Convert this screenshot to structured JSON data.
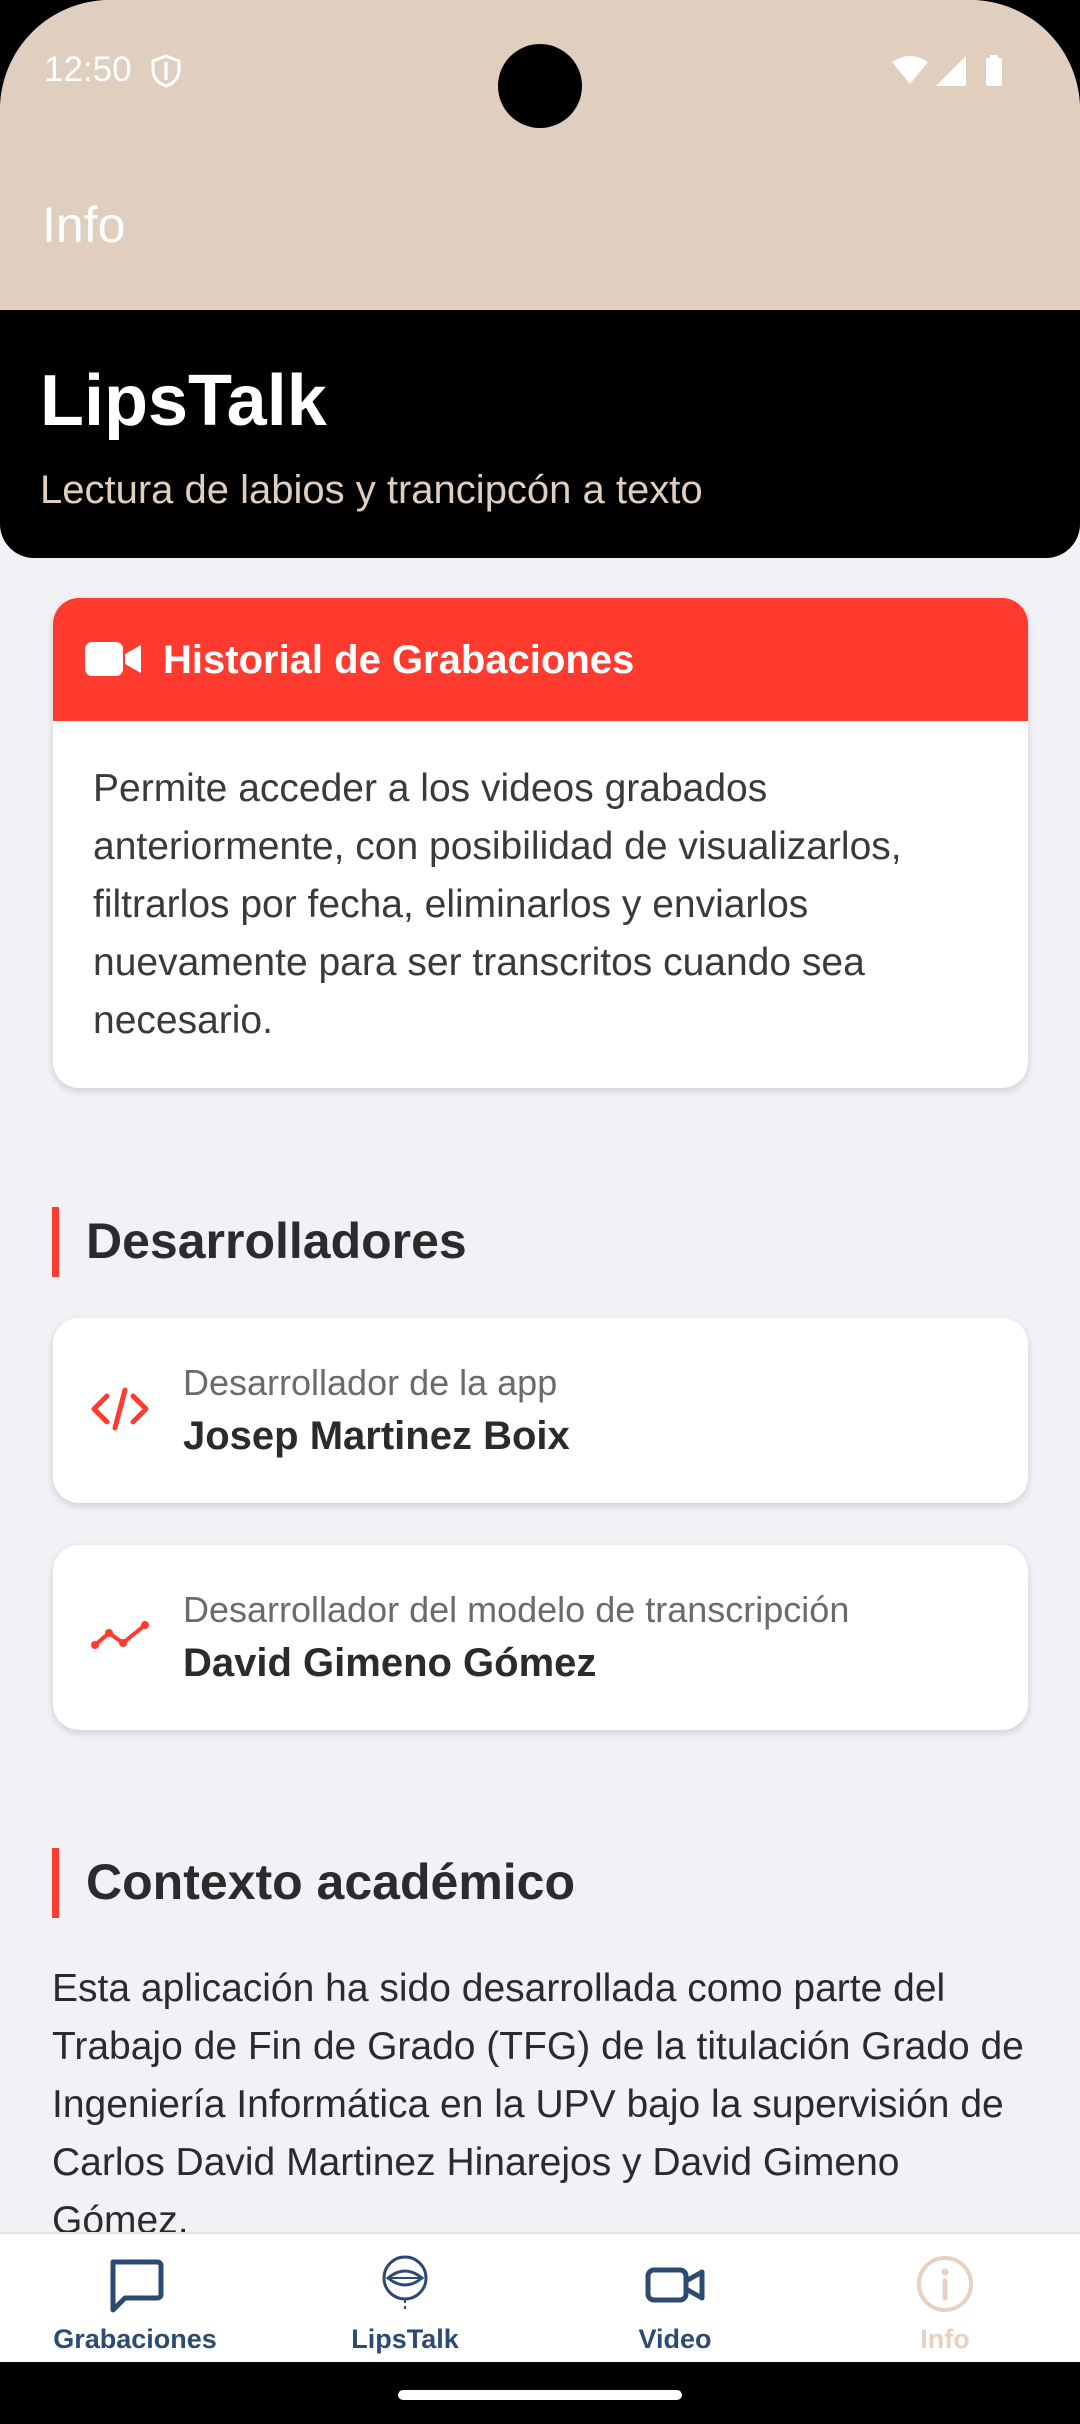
{
  "status_bar": {
    "time": "12:50"
  },
  "app_bar": {
    "title": "Info"
  },
  "hero": {
    "title": "LipsTalk",
    "subtitle": "Lectura de labios y trancipcón a texto"
  },
  "feature_card": {
    "icon": "video-camera-icon",
    "title": "Historial de Grabaciones",
    "description": "Permite acceder a los videos grabados anteriormente, con posibilidad de visualizarlos, filtrarlos por fecha, eliminarlos y enviarlos nuevamente para ser transcritos cuando sea necesario."
  },
  "developers": {
    "section_title": "Desarrolladores",
    "items": [
      {
        "icon": "code-icon",
        "role": "Desarrollador de la app",
        "name": "Josep Martinez Boix"
      },
      {
        "icon": "line-chart-icon",
        "role": "Desarrollador del modelo de transcripción",
        "name": "David Gimeno Gómez"
      }
    ]
  },
  "context": {
    "section_title": "Contexto académico",
    "text": "Esta aplicación ha sido desarrollada como parte del Trabajo de Fin de Grado (TFG) de la titulación Grado de Ingeniería Informática en la UPV bajo la supervisión de Carlos David Martinez Hinarejos y David Gimeno Gómez."
  },
  "tab_bar": {
    "items": [
      {
        "label": "Grabaciones",
        "icon": "chat-bubble-icon",
        "active": false
      },
      {
        "label": "LipsTalk",
        "icon": "lips-talk-icon",
        "active": false
      },
      {
        "label": "Video",
        "icon": "video-camera-icon",
        "active": false
      },
      {
        "label": "Info",
        "icon": "info-icon",
        "active": true
      }
    ]
  },
  "colors": {
    "accent": "#ff3b30",
    "header_beige": "#e0cfbf",
    "tab_inactive": "#2d4a72",
    "tab_active": "#e6d2c0",
    "background": "#f2f2f6"
  }
}
